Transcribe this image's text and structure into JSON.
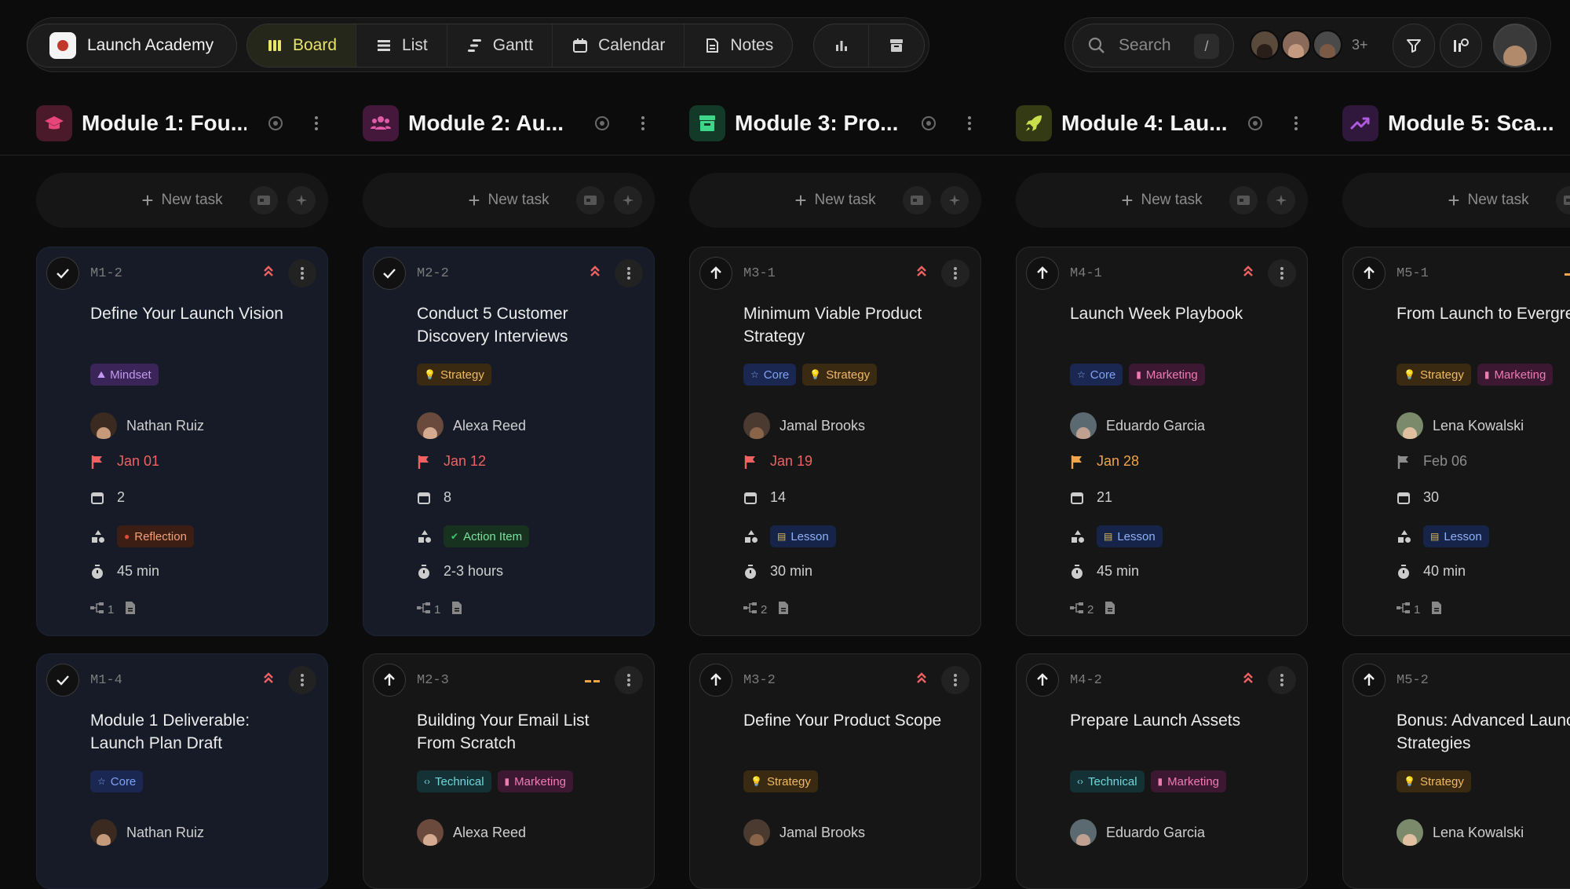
{
  "app": {
    "title": "Launch Academy"
  },
  "views": [
    {
      "label": "Board",
      "icon": "board-icon",
      "active": true
    },
    {
      "label": "List",
      "icon": "list-icon",
      "active": false
    },
    {
      "label": "Gantt",
      "icon": "gantt-icon",
      "active": false
    },
    {
      "label": "Calendar",
      "icon": "calendar-icon",
      "active": false
    },
    {
      "label": "Notes",
      "icon": "notes-icon",
      "active": false
    }
  ],
  "search": {
    "placeholder": "Search",
    "shortcut": "/"
  },
  "collaborators": {
    "more": "3+"
  },
  "new_task_label": "New task",
  "columns": [
    {
      "title": "Module 1: Fou...",
      "icon_color": "#e8457a",
      "icon_bg": "#4a1a2b"
    },
    {
      "title": "Module 2: Au...",
      "icon_color": "#e05aa8",
      "icon_bg": "#43183a"
    },
    {
      "title": "Module 3: Pro...",
      "icon_color": "#3fd68a",
      "icon_bg": "#133a28"
    },
    {
      "title": "Module 4: Lau...",
      "icon_color": "#c9e04a",
      "icon_bg": "#343a14"
    },
    {
      "title": "Module 5: Sca...",
      "icon_color": "#b05ae0",
      "icon_bg": "#30183d"
    }
  ],
  "cards": [
    {
      "id": "M1-2",
      "done": true,
      "priority": "high",
      "title": "Define Your Launch Vision",
      "tags": [
        {
          "label": "Mindset",
          "kind": "mindset"
        }
      ],
      "assignee": "Nathan Ruiz",
      "due": "Jan 01",
      "due_color": "#f06262",
      "day": "2",
      "kind": {
        "label": "Reflection",
        "kind": "reflection"
      },
      "duration": "45 min",
      "subtasks": "1"
    },
    {
      "id": "M2-2",
      "done": true,
      "priority": "high",
      "title": "Conduct 5 Customer Discovery Interviews",
      "tags": [
        {
          "label": "Strategy",
          "kind": "strategy"
        }
      ],
      "assignee": "Alexa Reed",
      "due": "Jan 12",
      "due_color": "#f06262",
      "day": "8",
      "kind": {
        "label": "Action Item",
        "kind": "action"
      },
      "duration": "2-3 hours",
      "subtasks": "1"
    },
    {
      "id": "M3-1",
      "done": false,
      "priority": "high",
      "title": "Minimum Viable Product Strategy",
      "tags": [
        {
          "label": "Core",
          "kind": "core"
        },
        {
          "label": "Strategy",
          "kind": "strategy"
        }
      ],
      "assignee": "Jamal Brooks",
      "due": "Jan 19",
      "due_color": "#f06262",
      "day": "14",
      "kind": {
        "label": "Lesson",
        "kind": "lesson"
      },
      "duration": "30 min",
      "subtasks": "2"
    },
    {
      "id": "M4-1",
      "done": false,
      "priority": "high",
      "title": "Launch Week Playbook",
      "tags": [
        {
          "label": "Core",
          "kind": "core"
        },
        {
          "label": "Marketing",
          "kind": "marketing"
        }
      ],
      "assignee": "Eduardo Garcia",
      "due": "Jan 28",
      "due_color": "#f0a54a",
      "day": "21",
      "kind": {
        "label": "Lesson",
        "kind": "lesson"
      },
      "duration": "45 min",
      "subtasks": "2"
    },
    {
      "id": "M5-1",
      "done": false,
      "priority": "medium",
      "title": "From Launch to Evergreen",
      "tags": [
        {
          "label": "Strategy",
          "kind": "strategy"
        },
        {
          "label": "Marketing",
          "kind": "marketing"
        }
      ],
      "assignee": "Lena Kowalski",
      "due": "Feb 06",
      "due_color": "#8c8c8c",
      "day": "30",
      "kind": {
        "label": "Lesson",
        "kind": "lesson"
      },
      "duration": "40 min",
      "subtasks": "1"
    }
  ],
  "cards2": [
    {
      "id": "M1-4",
      "done": true,
      "priority": "high",
      "title": "Module 1 Deliverable: Launch Plan Draft",
      "tags": [
        {
          "label": "Core",
          "kind": "core"
        }
      ],
      "assignee": "Nathan Ruiz"
    },
    {
      "id": "M2-3",
      "done": false,
      "priority": "medium",
      "title": "Building Your Email List From Scratch",
      "tags": [
        {
          "label": "Technical",
          "kind": "technical"
        },
        {
          "label": "Marketing",
          "kind": "marketing"
        }
      ],
      "assignee": "Alexa Reed"
    },
    {
      "id": "M3-2",
      "done": false,
      "priority": "high",
      "title": "Define Your Product Scope",
      "tags": [
        {
          "label": "Strategy",
          "kind": "strategy"
        }
      ],
      "assignee": "Jamal Brooks"
    },
    {
      "id": "M4-2",
      "done": false,
      "priority": "high",
      "title": "Prepare Launch Assets",
      "tags": [
        {
          "label": "Technical",
          "kind": "technical"
        },
        {
          "label": "Marketing",
          "kind": "marketing"
        }
      ],
      "assignee": "Eduardo Garcia"
    },
    {
      "id": "M5-2",
      "done": false,
      "priority": "low",
      "title": "Bonus: Advanced Launch Strategies",
      "tags": [
        {
          "label": "Strategy",
          "kind": "strategy"
        }
      ],
      "assignee": "Lena Kowalski"
    }
  ]
}
